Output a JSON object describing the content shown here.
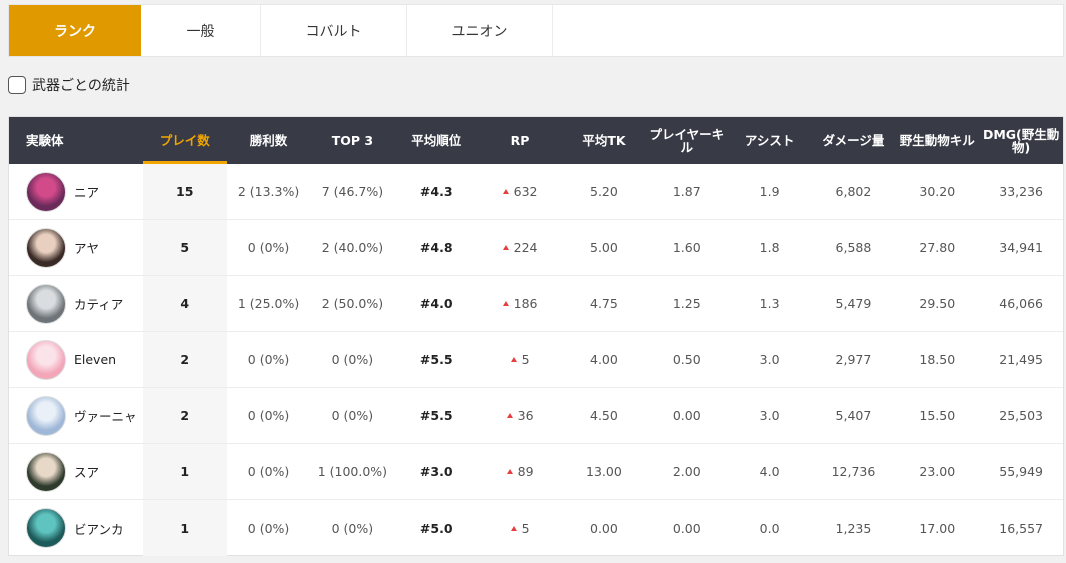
{
  "tabs": [
    {
      "label": "ランク",
      "active": true
    },
    {
      "label": "一般",
      "active": false
    },
    {
      "label": "コバルト",
      "active": false
    },
    {
      "label": "ユニオン",
      "active": false
    }
  ],
  "filter": {
    "checkbox_label": "武器ごとの統計",
    "checked": false
  },
  "table": {
    "headers": [
      "実験体",
      "プレイ数",
      "勝利数",
      "TOP 3",
      "平均順位",
      "RP",
      "平均TK",
      "プレイヤーキル",
      "アシスト",
      "ダメージ量",
      "野生動物キル",
      "DMG(野生動物)"
    ],
    "sorted_column": "プレイ数",
    "accent_color": "#e09a00",
    "rows": [
      {
        "name": "ニア",
        "plays": "15",
        "wins": "2 (13.3%)",
        "top3": "7 (46.7%)",
        "avg_rank": "#4.3",
        "rp": "632",
        "avg_tk": "5.20",
        "pk": "1.87",
        "assist": "1.9",
        "damage": "6,802",
        "animal_kills": "30.20",
        "dmg_animal": "33,236",
        "avatar_colors": [
          "#6a2a5a",
          "#d24a8a"
        ]
      },
      {
        "name": "アヤ",
        "plays": "5",
        "wins": "0 (0%)",
        "top3": "2 (40.0%)",
        "avg_rank": "#4.8",
        "rp": "224",
        "avg_tk": "5.00",
        "pk": "1.60",
        "assist": "1.8",
        "damage": "6,588",
        "animal_kills": "27.80",
        "dmg_animal": "34,941",
        "avatar_colors": [
          "#3a2a26",
          "#e8cfc0"
        ]
      },
      {
        "name": "カティア",
        "plays": "4",
        "wins": "1 (25.0%)",
        "top3": "2 (50.0%)",
        "avg_rank": "#4.0",
        "rp": "186",
        "avg_tk": "4.75",
        "pk": "1.25",
        "assist": "1.3",
        "damage": "5,479",
        "animal_kills": "29.50",
        "dmg_animal": "46,066",
        "avatar_colors": [
          "#6e7478",
          "#d9dde0"
        ]
      },
      {
        "name": "Eleven",
        "plays": "2",
        "wins": "0 (0%)",
        "top3": "0 (0%)",
        "avg_rank": "#5.5",
        "rp": "5",
        "avg_tk": "4.00",
        "pk": "0.50",
        "assist": "3.0",
        "damage": "2,977",
        "animal_kills": "18.50",
        "dmg_animal": "21,495",
        "avatar_colors": [
          "#f2a6b8",
          "#fbe3ea"
        ]
      },
      {
        "name": "ヴァーニャ",
        "plays": "2",
        "wins": "0 (0%)",
        "top3": "0 (0%)",
        "avg_rank": "#5.5",
        "rp": "36",
        "avg_tk": "4.50",
        "pk": "0.00",
        "assist": "3.0",
        "damage": "5,407",
        "animal_kills": "15.50",
        "dmg_animal": "25,503",
        "avatar_colors": [
          "#9fb8d8",
          "#e9f0f8"
        ]
      },
      {
        "name": "スア",
        "plays": "1",
        "wins": "0 (0%)",
        "top3": "1 (100.0%)",
        "avg_rank": "#3.0",
        "rp": "89",
        "avg_tk": "13.00",
        "pk": "2.00",
        "assist": "4.0",
        "damage": "12,736",
        "animal_kills": "23.00",
        "dmg_animal": "55,949",
        "avatar_colors": [
          "#2e3a2c",
          "#e8d8c8"
        ]
      },
      {
        "name": "ビアンカ",
        "plays": "1",
        "wins": "0 (0%)",
        "top3": "0 (0%)",
        "avg_rank": "#5.0",
        "rp": "5",
        "avg_tk": "0.00",
        "pk": "0.00",
        "assist": "0.0",
        "damage": "1,235",
        "animal_kills": "17.00",
        "dmg_animal": "16,557",
        "avatar_colors": [
          "#1d5a5a",
          "#5fc4c0"
        ]
      }
    ]
  }
}
